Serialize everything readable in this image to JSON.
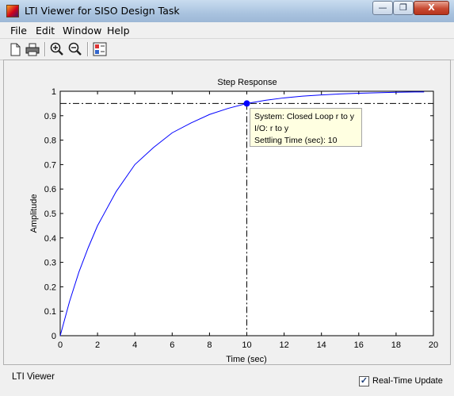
{
  "window": {
    "title": "LTI Viewer for SISO Design Task",
    "min_label": "—",
    "max_label": "❐",
    "close_label": "X"
  },
  "menu": [
    "File",
    "Edit",
    "Window",
    "Help"
  ],
  "toolbar": {
    "icons": [
      "new-file-icon",
      "print-icon",
      "zoom-in-icon",
      "zoom-out-icon",
      "plot-configuration-icon"
    ]
  },
  "chart_data": {
    "type": "line",
    "title": "Step Response",
    "xlabel": "Time (sec)",
    "ylabel": "Amplitude",
    "xlim": [
      0,
      20
    ],
    "ylim": [
      0,
      1
    ],
    "xticks": [
      "0",
      "2",
      "4",
      "6",
      "8",
      "10",
      "12",
      "14",
      "16",
      "18",
      "20"
    ],
    "yticks": [
      "0",
      "0.1",
      "0.2",
      "0.3",
      "0.4",
      "0.5",
      "0.6",
      "0.7",
      "0.8",
      "0.9",
      "1"
    ],
    "grid": false,
    "series": [
      {
        "color": "#0000ff",
        "x": [
          0,
          0.5,
          1,
          1.5,
          2,
          3,
          4,
          5,
          6,
          7,
          8,
          9,
          10,
          11,
          12,
          13,
          14,
          15,
          16,
          17,
          18,
          19,
          19.5
        ],
        "y": [
          0,
          0.14,
          0.26,
          0.36,
          0.45,
          0.59,
          0.7,
          0.77,
          0.83,
          0.87,
          0.905,
          0.93,
          0.95,
          0.963,
          0.973,
          0.98,
          0.985,
          0.989,
          0.992,
          0.994,
          0.996,
          0.997,
          0.997
        ]
      }
    ],
    "reference_lines": {
      "final_value": 1,
      "settling_level": 0.95,
      "settling_time": 10
    },
    "marker": {
      "x": 10,
      "y": 0.95,
      "color": "#0000ff"
    },
    "datatip": [
      "System: Closed Loop r to y",
      "I/O: r to y",
      "Settling Time (sec): 10"
    ]
  },
  "status": {
    "text": "LTI Viewer",
    "realtime_label": "Real-Time Update",
    "realtime_checked": true,
    "check_mark": "✓"
  }
}
